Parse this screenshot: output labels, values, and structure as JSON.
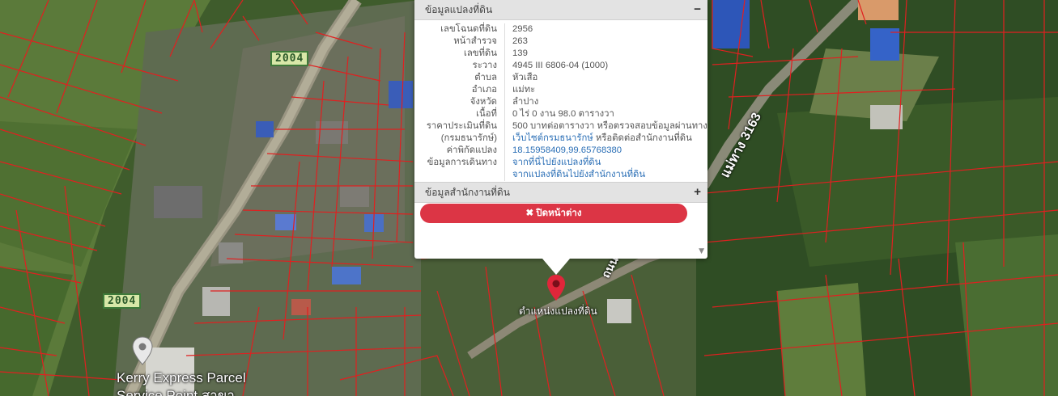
{
  "map": {
    "road_badge_1": "2004",
    "road_badge_2": "2004",
    "road_name_right": "แม่ทาง 3163",
    "road_name_mid": "ถนน",
    "poi_label_line1": "Kerry Express Parcel",
    "poi_label_line2": "Service Point สาขา",
    "marker_label": "ตำแหน่งแปลงที่ดิน",
    "marker_color": "#e0263a",
    "parcel_line_color": "#e02020"
  },
  "popup": {
    "section1_title": "ข้อมูลแปลงที่ดิน",
    "section1_toggle": "−",
    "section2_title": "ข้อมูลสำนักงานที่ดิน",
    "section2_toggle": "+",
    "close_label": "✖ ปิดหน้าต่าง",
    "rows": [
      {
        "key": "เลขโฉนดที่ดิน",
        "value": "2956"
      },
      {
        "key": "หน้าสำรวจ",
        "value": "263"
      },
      {
        "key": "เลขที่ดิน",
        "value": "139"
      },
      {
        "key": "ระวาง",
        "value": "4945 III 6806-04 (1000)"
      },
      {
        "key": "ตำบล",
        "value": "หัวเสือ"
      },
      {
        "key": "อำเภอ",
        "value": "แม่ทะ"
      },
      {
        "key": "จังหวัด",
        "value": "ลำปาง"
      },
      {
        "key": "เนื้อที่",
        "value": "0 ไร่ 0 งาน 98.0 ตารางวา"
      },
      {
        "key": "ราคาประเมินที่ดิน",
        "value": "500 บาทต่อตารางวา หรือตรวจสอบข้อมูลผ่านทาง"
      },
      {
        "key": "(กรมธนารักษ์)",
        "value_link": "เว็บไซต์กรมธนารักษ์",
        "value_rest": " หรือติดต่อสำนักงานที่ดิน"
      },
      {
        "key": "ค่าพิกัดแปลง",
        "value": "18.15958409,99.65768380"
      },
      {
        "key": "ข้อมูลการเดินทาง",
        "value": "จากที่นี่ไปยังแปลงที่ดิน"
      },
      {
        "key": "",
        "value": "จากแปลงที่ดินไปยังสำนักงานที่ดิน"
      }
    ],
    "scroll_arrow": "▼"
  }
}
